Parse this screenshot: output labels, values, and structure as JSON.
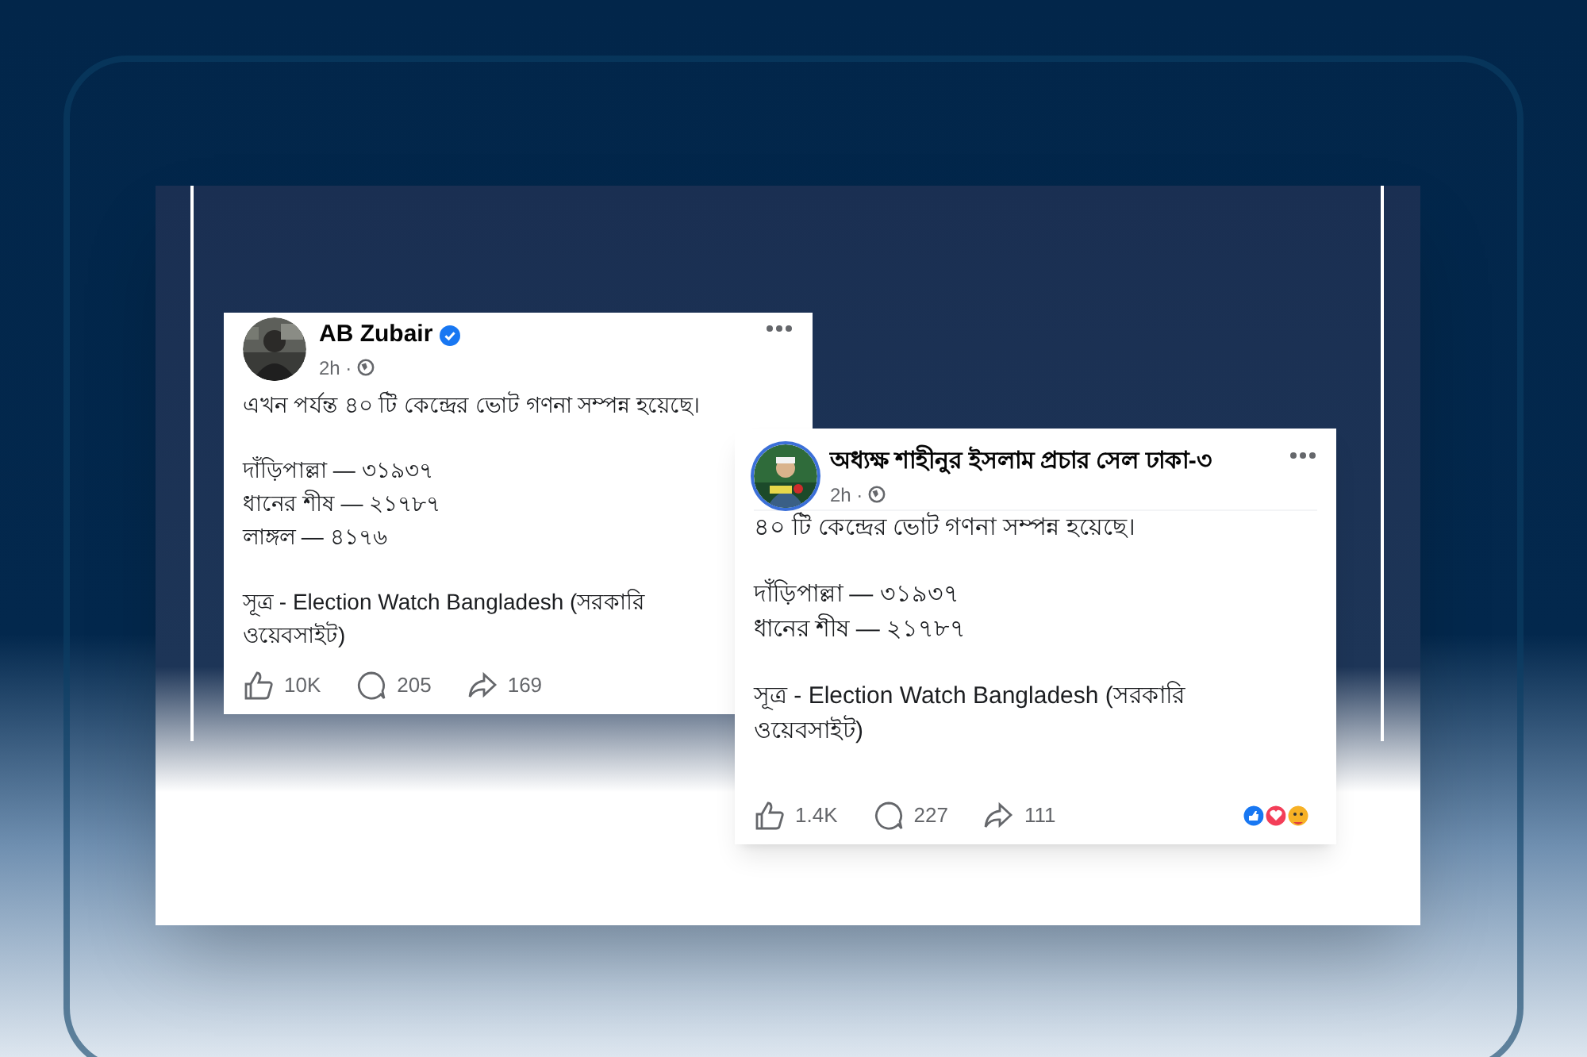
{
  "posts": [
    {
      "author": "AB Zubair",
      "verified": true,
      "time": "2h ·",
      "paragraphs": [
        [
          "এখন পর্যন্ত ৪০ টি কেন্দ্রের ভোট গণনা সম্পন্ন হয়েছে।"
        ],
        [
          "দাঁড়িপাল্লা — ৩১৯৩৭",
          "ধানের শীষ — ২১৭৮৭",
          "লাঙ্গল — ৪১৭৬"
        ],
        [
          "সূত্র - Election Watch Bangladesh (সরকারি ওয়েবসাইট)"
        ]
      ],
      "likes": "10K",
      "comments": "205",
      "shares": "169",
      "reactions": false
    },
    {
      "author": "অধ্যক্ষ শাহীনুর ইসলাম প্রচার সেল ঢাকা-৩",
      "verified": false,
      "time": "2h ·",
      "paragraphs": [
        [
          "৪০ টি কেন্দ্রের ভোট গণনা সম্পন্ন হয়েছে।"
        ],
        [
          "দাঁড়িপাল্লা — ৩১৯৩৭",
          "ধানের শীষ — ২১৭৮৭"
        ],
        [
          "সূত্র - Election Watch Bangladesh (সরকারি ওয়েবসাইট)"
        ]
      ],
      "likes": "1.4K",
      "comments": "227",
      "shares": "111",
      "reactions": true
    }
  ]
}
